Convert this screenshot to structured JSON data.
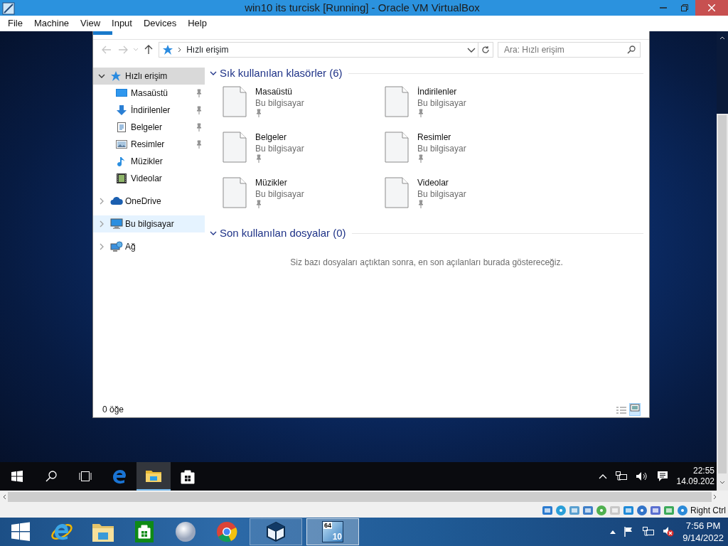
{
  "host_window": {
    "title": "win10 its turcisk [Running] - Oracle VM VirtualBox"
  },
  "menu": [
    "File",
    "Machine",
    "View",
    "Input",
    "Devices",
    "Help"
  ],
  "explorer": {
    "address": "Hızlı erişim",
    "search": {
      "placeholder": "Ara: Hızlı erişim"
    },
    "nav": [
      {
        "label": "Hızlı erişim",
        "kind": "star",
        "expanded": true,
        "selected": true,
        "hovered": false,
        "children": [
          {
            "label": "Masaüstü",
            "kind": "desktop",
            "pinned": true
          },
          {
            "label": "İndirilenler",
            "kind": "download",
            "pinned": true
          },
          {
            "label": "Belgeler",
            "kind": "document",
            "pinned": true
          },
          {
            "label": "Resimler",
            "kind": "pictures",
            "pinned": true
          },
          {
            "label": "Müzikler",
            "kind": "music",
            "pinned": false
          },
          {
            "label": "Videolar",
            "kind": "video",
            "pinned": false
          }
        ]
      },
      {
        "label": "OneDrive",
        "kind": "cloud",
        "expanded": false,
        "selected": false,
        "hovered": false
      },
      {
        "label": "Bu bilgisayar",
        "kind": "computer",
        "expanded": false,
        "selected": false,
        "hovered": true
      },
      {
        "label": "Ağ",
        "kind": "network",
        "expanded": false,
        "selected": false,
        "hovered": false
      }
    ],
    "sections": [
      {
        "title": "Sık kullanılan klasörler (6)",
        "expanded": true,
        "items": [
          {
            "name": "Masaüstü",
            "location": "Bu bilgisayar",
            "pinned": true
          },
          {
            "name": "İndirilenler",
            "location": "Bu bilgisayar",
            "pinned": true
          },
          {
            "name": "Belgeler",
            "location": "Bu bilgisayar",
            "pinned": true
          },
          {
            "name": "Resimler",
            "location": "Bu bilgisayar",
            "pinned": true
          },
          {
            "name": "Müzikler",
            "location": "Bu bilgisayar",
            "pinned": true
          },
          {
            "name": "Videolar",
            "location": "Bu bilgisayar",
            "pinned": true
          }
        ]
      },
      {
        "title": "Son kullanılan dosyalar (0)",
        "expanded": true,
        "empty_text": "Siz bazı dosyaları açtıktan sonra, en son açılanları burada göstereceğiz."
      }
    ],
    "status": "0 öğe"
  },
  "vm_taskbar": {
    "items": [
      {
        "kind": "start",
        "selected": false
      },
      {
        "kind": "search",
        "selected": false
      },
      {
        "kind": "taskview",
        "selected": false
      },
      {
        "kind": "edge",
        "selected": false
      },
      {
        "kind": "folder",
        "selected": true
      },
      {
        "kind": "store",
        "selected": false
      }
    ],
    "time": "22:55",
    "date": "14.09.202"
  },
  "vbox_status": {
    "host_key": "Right Ctrl"
  },
  "host_taskbar": {
    "items": [
      {
        "kind": "start",
        "running": false,
        "selected": false
      },
      {
        "kind": "ie",
        "running": false,
        "selected": false
      },
      {
        "kind": "folder",
        "running": false,
        "selected": false
      },
      {
        "kind": "store",
        "running": false,
        "selected": false
      },
      {
        "kind": "sphere",
        "running": false,
        "selected": false
      },
      {
        "kind": "chrome",
        "running": false,
        "selected": false
      },
      {
        "kind": "virtualbox",
        "running": true,
        "selected": false
      },
      {
        "kind": "vm",
        "running": true,
        "selected": true,
        "badge": "64",
        "number": "10"
      }
    ],
    "time": "7:56 PM",
    "date": "9/14/2022"
  }
}
